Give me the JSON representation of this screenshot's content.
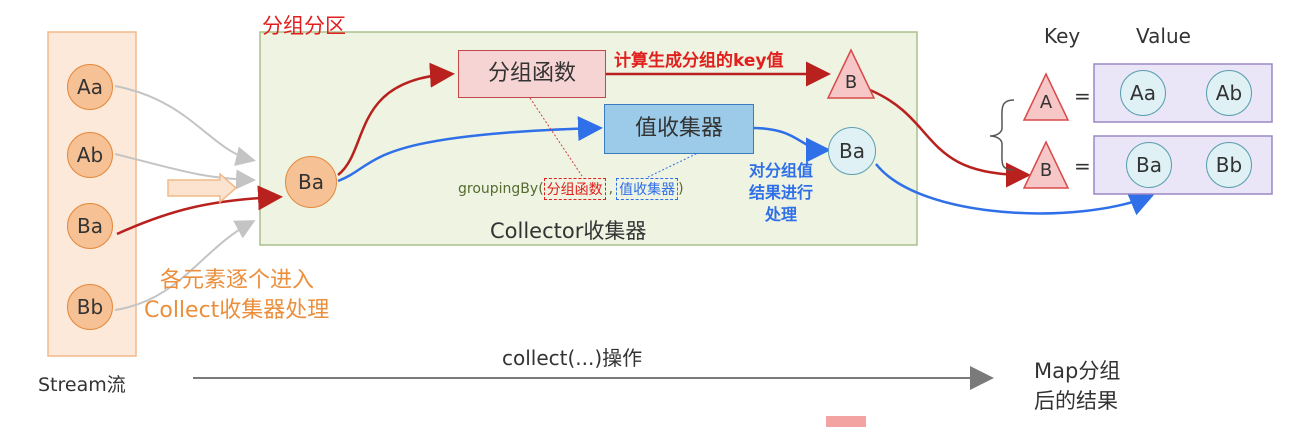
{
  "stream": {
    "items": [
      "Aa",
      "Ab",
      "Ba",
      "Bb"
    ],
    "label": "Stream流",
    "note_line1": "各元素逐个进入",
    "note_line2": "Collect收集器处理"
  },
  "collector": {
    "title": "分组分区",
    "name": "Collector收集器",
    "current_element": "Ba",
    "group_fn_box": "分组函数",
    "group_fn_caption": "计算生成分组的key值",
    "key_result": "B",
    "value_collector_box": "值收集器",
    "value_collector_caption_line1": "对分组值",
    "value_collector_caption_line2": "结果进行",
    "value_collector_caption_line3": "处理",
    "value_result": "Ba",
    "grouping_prefix": "groupingBy(",
    "grouping_arg1": "分组函数",
    "grouping_sep": ",",
    "grouping_arg2": "值收集器",
    "grouping_suffix": ")"
  },
  "operation": {
    "label": "collect(...)操作"
  },
  "result_map": {
    "key_header": "Key",
    "value_header": "Value",
    "rows": [
      {
        "key": "A",
        "eq": "=",
        "values": [
          "Aa",
          "Ab"
        ]
      },
      {
        "key": "B",
        "eq": "=",
        "values": [
          "Ba",
          "Bb"
        ]
      }
    ],
    "label_line1": "Map分组",
    "label_line2": "后的结果"
  },
  "colors": {
    "orange_fill": "#f6c194",
    "orange_border": "#e38a3e",
    "green_fill": "#eef3e2",
    "green_border": "#a8c08a",
    "red": "#b8211e",
    "blue": "#2f6fe8",
    "purple_fill": "#eae6f7",
    "purple_border": "#9b87c6",
    "teal_fill": "#dff1f4",
    "teal_border": "#5b9fb0"
  }
}
